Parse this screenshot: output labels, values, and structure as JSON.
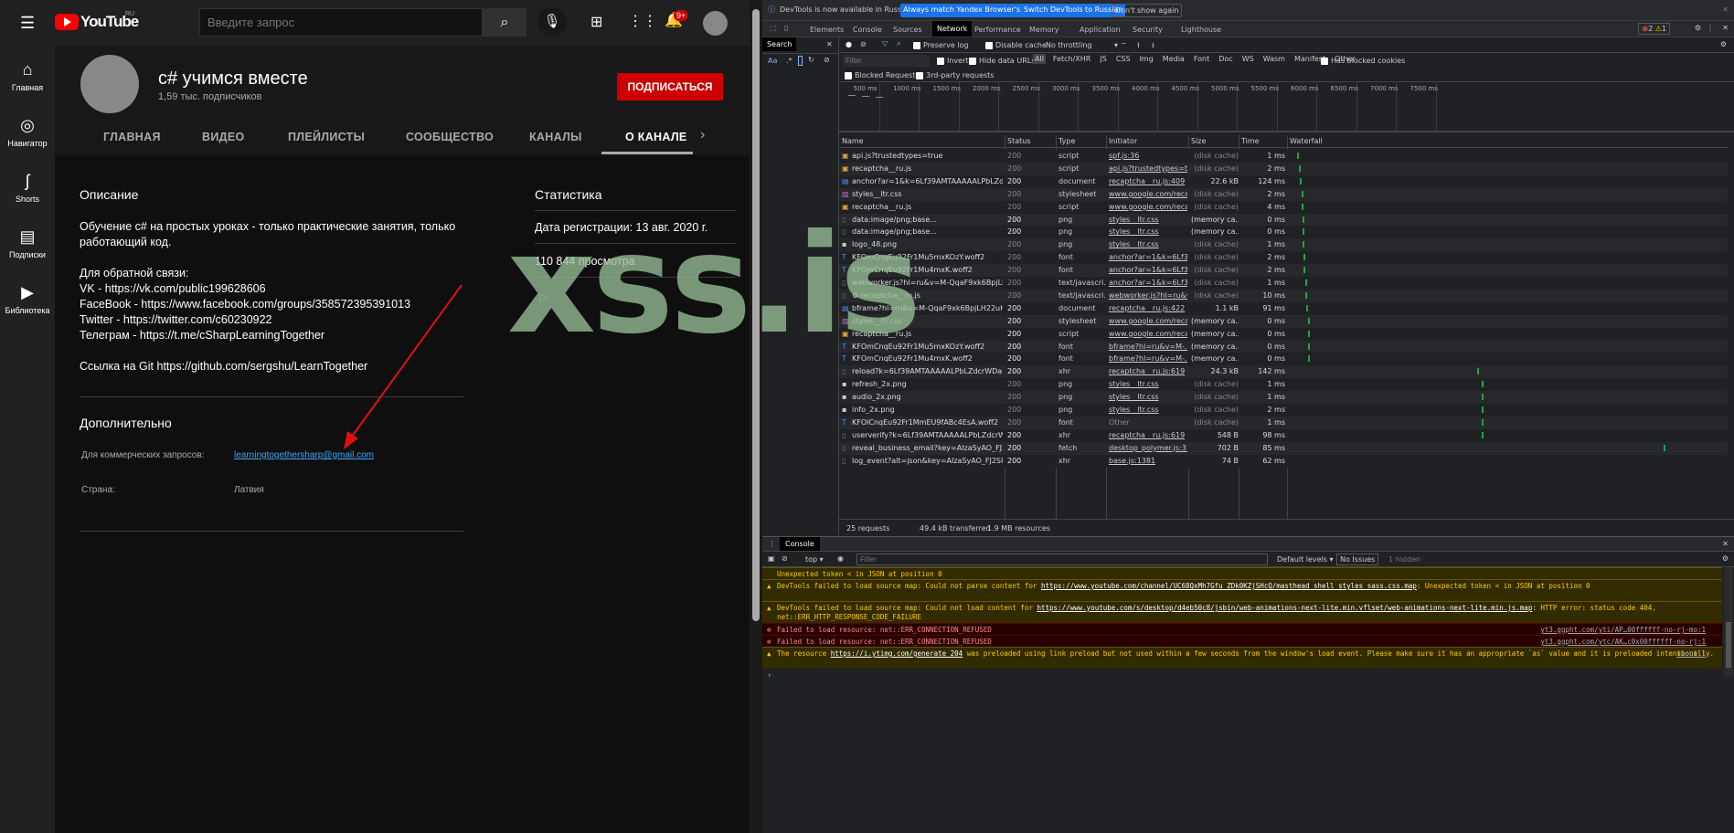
{
  "youtube": {
    "logo_text": "YouTube",
    "logo_region": "RU",
    "search_placeholder": "Введите запрос",
    "notif_badge": "9+",
    "sidebar": [
      {
        "label": "Главная",
        "icon": "home-icon"
      },
      {
        "label": "Навигатор",
        "icon": "compass-icon"
      },
      {
        "label": "Shorts",
        "icon": "shorts-icon"
      },
      {
        "label": "Подписки",
        "icon": "subscriptions-icon"
      },
      {
        "label": "Библиотека",
        "icon": "library-icon"
      }
    ],
    "channel": {
      "name": "c# учимся вместе",
      "subscribers": "1,59 тыс. подписчиков",
      "subscribe_label": "ПОДПИСАТЬСЯ"
    },
    "tabs": [
      "ГЛАВНАЯ",
      "ВИДЕО",
      "ПЛЕЙЛИСТЫ",
      "СООБЩЕСТВО",
      "КАНАЛЫ",
      "О КАНАЛЕ"
    ],
    "about": {
      "desc_title": "Описание",
      "desc_lines": [
        "Обучение c# на простых уроках - только практические занятия, только",
        "работающий код.",
        "",
        "Для обратной связи:",
        "VK - https://vk.com/public199628606",
        "FaceBook - https://www.facebook.com/groups/358572395391013",
        "Twitter -  https://twitter.com/c60230922",
        "Телеграм - https://t.me/cSharpLearningTogether",
        "",
        "Ссылка на Git https://github.com/sergshu/LearnTogether"
      ],
      "extra_title": "Дополнительно",
      "business_label": "Для коммерческих запросов:",
      "business_email": "learningtogethersharp@gmail.com",
      "country_label": "Страна:",
      "country": "Латвия",
      "stats_title": "Статистика",
      "registered": "Дата регистрации: 13 авг. 2020 г.",
      "views": "110 844 просмотра"
    }
  },
  "watermark": "xss.is",
  "devtools": {
    "info": "DevTools is now available in Russian!",
    "btn_match": "Always match Yandex Browser's language",
    "btn_switch": "Switch DevTools to Russian",
    "btn_dont": "Don't show again",
    "tabs": [
      "Elements",
      "Console",
      "Sources",
      "Network",
      "Performance",
      "Memory",
      "Application",
      "Security",
      "Lighthouse"
    ],
    "errors": "2",
    "warnings": "1",
    "search_tab": "Search",
    "search_opts": [
      "Aa",
      ".*"
    ],
    "preserve_log": "Preserve log",
    "disable_cache": "Disable cache",
    "throttling": "No throttling",
    "filter_placeholder": "Filter",
    "invert": "Invert",
    "hide_data_urls": "Hide data URLs",
    "types": [
      "All",
      "Fetch/XHR",
      "JS",
      "CSS",
      "Img",
      "Media",
      "Font",
      "Doc",
      "WS",
      "Wasm",
      "Manifest",
      "Other"
    ],
    "has_blocked": "Has blocked cookies",
    "blocked_requests": "Blocked Requests",
    "third_party": "3rd-party requests",
    "ticks": [
      "500 ms",
      "1000 ms",
      "1500 ms",
      "2000 ms",
      "2500 ms",
      "3000 ms",
      "3500 ms",
      "4000 ms",
      "4500 ms",
      "5000 ms",
      "5500 ms",
      "6000 ms",
      "6500 ms",
      "7000 ms",
      "7500 ms"
    ],
    "columns": [
      "Name",
      "Status",
      "Type",
      "Initiator",
      "Size",
      "Time",
      "Waterfall"
    ],
    "rows": [
      {
        "name": "api.js?trustedtypes=true",
        "status": "200",
        "type": "script",
        "initiator": "spf.js:36",
        "size": "(disk cache)",
        "time": "1 ms",
        "icon": "script",
        "wf": 40
      },
      {
        "name": "recaptcha__ru.js",
        "status": "200",
        "type": "script",
        "initiator": "api.js?trustedtypes=tr...",
        "size": "(disk cache)",
        "time": "2 ms",
        "icon": "script",
        "wf": 45
      },
      {
        "name": "anchor?ar=1&k=6Lf39AMTAAAAALPbLZdcr...",
        "status": "200",
        "type": "document",
        "initiator": "recaptcha__ru.js:409",
        "size": "22.6 kB",
        "time": "124 ms",
        "icon": "doc",
        "wf": 50
      },
      {
        "name": "styles__ltr.css",
        "status": "200",
        "type": "stylesheet",
        "initiator": "www.google.com/reca...",
        "size": "(disk cache)",
        "time": "2 ms",
        "icon": "css",
        "wf": 60
      },
      {
        "name": "recaptcha__ru.js",
        "status": "200",
        "type": "script",
        "initiator": "www.google.com/reca...",
        "size": "(disk cache)",
        "time": "4 ms",
        "icon": "script",
        "wf": 60
      },
      {
        "name": "data:image/png;base...",
        "status": "200",
        "type": "png",
        "initiator": "styles__ltr.css",
        "size": "(memory ca...",
        "time": "0 ms",
        "icon": "blank",
        "wf": 65
      },
      {
        "name": "data:image/png;base...",
        "status": "200",
        "type": "png",
        "initiator": "styles__ltr.css",
        "size": "(memory ca...",
        "time": "0 ms",
        "icon": "blank",
        "wf": 65
      },
      {
        "name": "logo_48.png",
        "status": "200",
        "type": "png",
        "initiator": "styles__ltr.css",
        "size": "(disk cache)",
        "time": "1 ms",
        "icon": "img",
        "wf": 65
      },
      {
        "name": "KFOmCnqEu92Fr1Mu5mxKOzY.woff2",
        "status": "200",
        "type": "font",
        "initiator": "anchor?ar=1&k=6Lf3...",
        "size": "(disk cache)",
        "time": "2 ms",
        "icon": "font",
        "wf": 70
      },
      {
        "name": "KFOmCnqEu92Fr1Mu4mxK.woff2",
        "status": "200",
        "type": "font",
        "initiator": "anchor?ar=1&k=6Lf3...",
        "size": "(disk cache)",
        "time": "2 ms",
        "icon": "font",
        "wf": 70
      },
      {
        "name": "webworker.js?hl=ru&v=M-QqaF9xk6BpjLH2...",
        "status": "200",
        "type": "text/javascri...",
        "initiator": "anchor?ar=1&k=6Lf3...",
        "size": "(disk cache)",
        "time": "1 ms",
        "icon": "blank",
        "wf": 75
      },
      {
        "name": "⚙ recaptcha__ru.js",
        "status": "200",
        "type": "text/javascri...",
        "initiator": "webworker.js?hl=ru&v...",
        "size": "(disk cache)",
        "time": "10 ms",
        "icon": "blank",
        "wf": 75
      },
      {
        "name": "bframe?hl=ru&v=M-QqaF9xk6BpjLH22uHZ...",
        "status": "200",
        "type": "document",
        "initiator": "recaptcha__ru.js:422",
        "size": "1.1 kB",
        "time": "91 ms",
        "icon": "doc",
        "wf": 80
      },
      {
        "name": "styles__ltr.css",
        "status": "200",
        "type": "stylesheet",
        "initiator": "www.google.com/reca...",
        "size": "(memory ca...",
        "time": "0 ms",
        "icon": "css",
        "wf": 90
      },
      {
        "name": "recaptcha__ru.js",
        "status": "200",
        "type": "script",
        "initiator": "www.google.com/reca...",
        "size": "(memory ca...",
        "time": "0 ms",
        "icon": "script",
        "wf": 90
      },
      {
        "name": "KFOmCnqEu92Fr1Mu5mxKOzY.woff2",
        "status": "200",
        "type": "font",
        "initiator": "bframe?hl=ru&v=M-...",
        "size": "(memory ca...",
        "time": "0 ms",
        "icon": "font",
        "wf": 90
      },
      {
        "name": "KFOmCnqEu92Fr1Mu4mxK.woff2",
        "status": "200",
        "type": "font",
        "initiator": "bframe?hl=ru&v=M-...",
        "size": "(memory ca...",
        "time": "0 ms",
        "icon": "font",
        "wf": 90
      },
      {
        "name": "reload?k=6Lf39AMTAAAAALPbLZdcrWDa8Y...",
        "status": "200",
        "type": "xhr",
        "initiator": "recaptcha__ru.js:619",
        "size": "24.3 kB",
        "time": "142 ms",
        "icon": "blank",
        "wf": 880
      },
      {
        "name": "refresh_2x.png",
        "status": "200",
        "type": "png",
        "initiator": "styles__ltr.css",
        "size": "(disk cache)",
        "time": "1 ms",
        "icon": "img",
        "wf": 900
      },
      {
        "name": "audio_2x.png",
        "status": "200",
        "type": "png",
        "initiator": "styles__ltr.css",
        "size": "(disk cache)",
        "time": "1 ms",
        "icon": "img",
        "wf": 900
      },
      {
        "name": "info_2x.png",
        "status": "200",
        "type": "png",
        "initiator": "styles__ltr.css",
        "size": "(disk cache)",
        "time": "2 ms",
        "icon": "img",
        "wf": 900
      },
      {
        "name": "KFOlCnqEu92Fr1MmEU9fABc4EsA.woff2",
        "status": "200",
        "type": "font",
        "initiator": "Other",
        "size": "(disk cache)",
        "time": "1 ms",
        "icon": "font",
        "wf": 900
      },
      {
        "name": "userverify?k=6Lf39AMTAAAAALPbLZdcrWD...",
        "status": "200",
        "type": "xhr",
        "initiator": "recaptcha__ru.js:619",
        "size": "548 B",
        "time": "98 ms",
        "icon": "blank",
        "wf": 900
      },
      {
        "name": "reveal_business_email?key=AIzaSyAO_FJ2SIq...",
        "status": "200",
        "type": "fetch",
        "initiator": "desktop_polymer.js:37...",
        "size": "702 B",
        "time": "85 ms",
        "icon": "blank",
        "wf": 1750
      },
      {
        "name": "log_event?alt=json&key=AIzaSyAO_FJ2SIqU...",
        "status": "200",
        "type": "xhr",
        "initiator": "base.js:1381",
        "size": "74 B",
        "time": "62 ms",
        "icon": "blank",
        "wf": 0
      }
    ],
    "summary": [
      "25 requests",
      "49.4 kB transferred",
      "1.9 MB resources"
    ],
    "console": {
      "tab": "Console",
      "context": "top",
      "filter_placeholder": "Filter",
      "levels": "Default levels",
      "issues": "No Issues",
      "hidden": "1 hidden",
      "messages": [
        {
          "level": "warn",
          "text": "Unexpected token < in JSON at position 0",
          "link": "",
          "tail": "",
          "src": ""
        },
        {
          "level": "warn",
          "text": "DevTools failed to load source map: Could not parse content for ",
          "link": "https://www.youtube.com/channel/UC68QxMh7Gfu ZDk0KZjSHcQ/masthead shell styles sass.css.map",
          "tail": ": Unexpected token < in JSON at position 0",
          "src": ""
        },
        {
          "level": "warn",
          "text": "DevTools failed to load source map: Could not load content for ",
          "link": "https://www.youtube.com/s/desktop/d4eb50c8/jsbin/web-animations-next-lite.min.vflset/web-animations-next-lite.min.js.map",
          "tail": ": HTTP error: status code 404, net::ERR_HTTP_RESPONSE_CODE_FAILURE",
          "src": ""
        },
        {
          "level": "error",
          "text": "Failed to load resource: net::ERR_CONNECTION_REFUSED",
          "link": "",
          "tail": "",
          "src": "yt3.ggpht.com/yti/AP…00ffffff-no-rj-mo:1"
        },
        {
          "level": "error",
          "text": "Failed to load resource: net::ERR_CONNECTION_REFUSED",
          "link": "",
          "tail": "",
          "src": "yt3.ggpht.com/ytc/AK…c0x00ffffff-no-rj:1"
        },
        {
          "level": "warn",
          "text": "The resource ",
          "link": "https://i.ytimg.com/generate 204",
          "tail": " was preloaded using link preload but not used within a few seconds from the window's load event. Please make sure it has an appropriate `as` value and it is preloaded intentionally.",
          "src": "about:1"
        }
      ]
    }
  },
  "colors": {
    "yt_red": "#cc0000",
    "devtools_blue": "#1a73e8",
    "waterfall_green": "#1ea446"
  }
}
